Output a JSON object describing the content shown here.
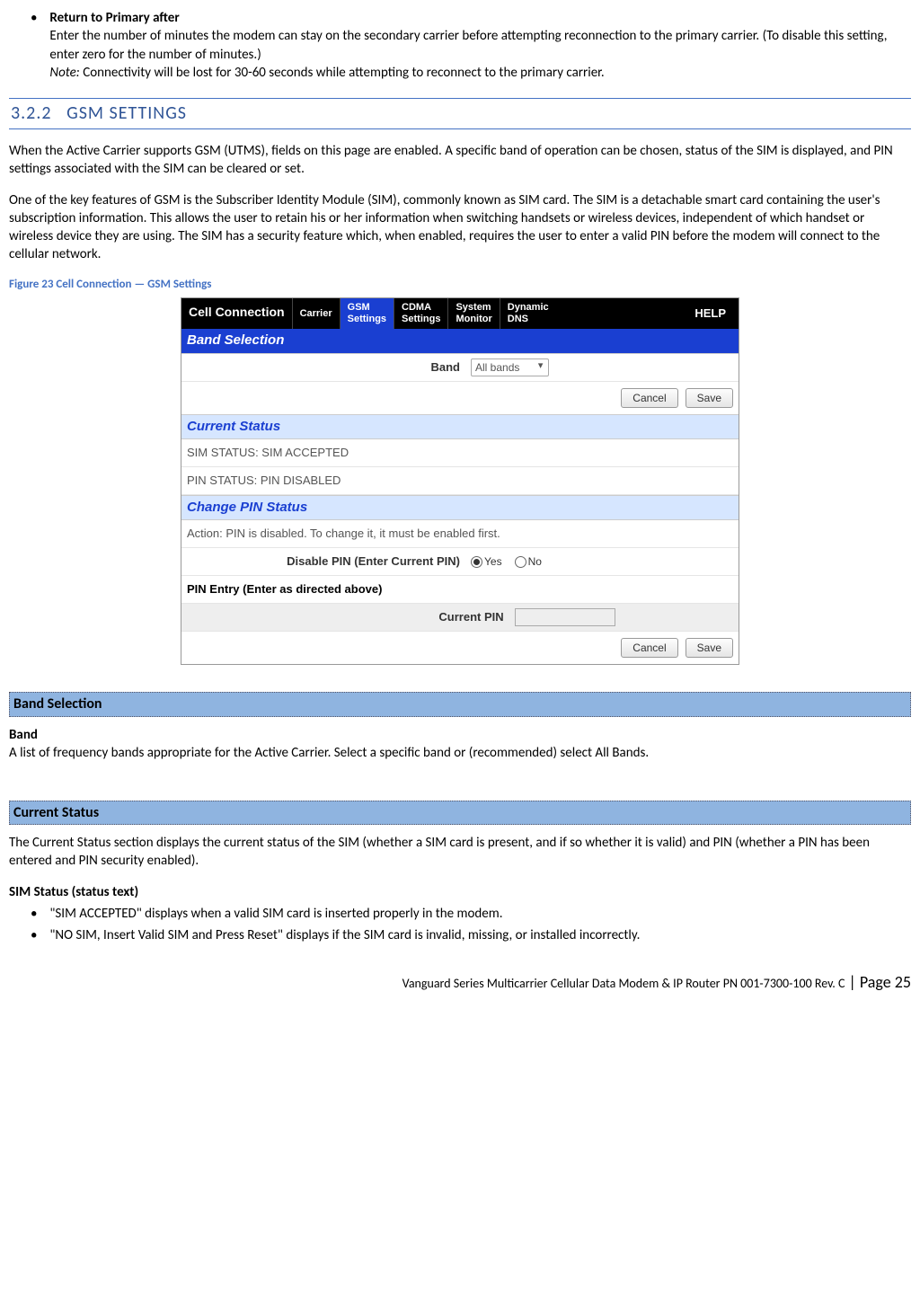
{
  "top_bullet": {
    "title": "Return to Primary after",
    "desc": "Enter the number of minutes the modem can stay on the secondary carrier before attempting reconnection to the primary carrier. (To disable this setting, enter zero for the number of minutes.)",
    "note_label": "Note:",
    "note_text": " Connectivity will be lost for 30-60 seconds while attempting to reconnect to the primary carrier."
  },
  "section": {
    "number": "3.2.2",
    "title": "GSM SETTINGS",
    "p1": "When the Active Carrier supports GSM (UTMS), fields on this page are enabled. A specific band of operation can be chosen, status of the SIM is displayed, and PIN settings associated with the SIM can be cleared or set.",
    "p2": "One of the key features of GSM is the Subscriber Identity Module (SIM), commonly known as SIM card. The SIM is a detachable smart card containing the user's subscription information. This allows the user to retain his or her information when switching handsets or wireless devices, independent of which handset or wireless device they are using. The SIM has a security feature which, when enabled, requires the user to enter a valid PIN before the modem will connect to the cellular network."
  },
  "figure_caption": "Figure 23 Cell Connection — GSM Settings",
  "screenshot": {
    "title": "Cell Connection",
    "tabs": {
      "carrier": "Carrier",
      "gsm": "GSM\nSettings",
      "cdma": "CDMA\nSettings",
      "system": "System\nMonitor",
      "ddns": "Dynamic\nDNS",
      "help": "HELP"
    },
    "band_section": "Band Selection",
    "band_label": "Band",
    "band_value": "All bands",
    "cancel": "Cancel",
    "save": "Save",
    "status_section": "Current Status",
    "sim_status": "SIM STATUS: SIM ACCEPTED",
    "pin_status": "PIN STATUS: PIN DISABLED",
    "change_pin_section": "Change PIN Status",
    "action_text": "Action: PIN is disabled. To change it, it must be enabled first.",
    "disable_pin_label": "Disable PIN (Enter Current PIN)",
    "yes": "Yes",
    "no": "No",
    "pin_entry_header": "PIN Entry (Enter as directed above)",
    "current_pin_label": "Current PIN"
  },
  "band_selection": {
    "header": "Band Selection",
    "term": "Band",
    "desc": "A list of frequency bands appropriate for the Active Carrier. Select a specific band or (recommended) select All Bands."
  },
  "current_status": {
    "header": "Current Status",
    "p": "The Current Status section displays the current status of the SIM (whether a SIM card is present, and if so whether it is valid) and PIN (whether a PIN has been entered and PIN security enabled).",
    "term": "SIM Status (status text)",
    "b1": "\"SIM ACCEPTED\" displays when a valid SIM card is inserted properly in the modem.",
    "b2": "\"NO SIM, Insert Valid SIM and Press Reset\" displays if the SIM card is invalid, missing, or installed incorrectly."
  },
  "footer": {
    "text": "Vanguard Series Multicarrier Cellular Data Modem & IP Router PN 001-7300-100 Rev. C",
    "page": " | Page 25"
  }
}
